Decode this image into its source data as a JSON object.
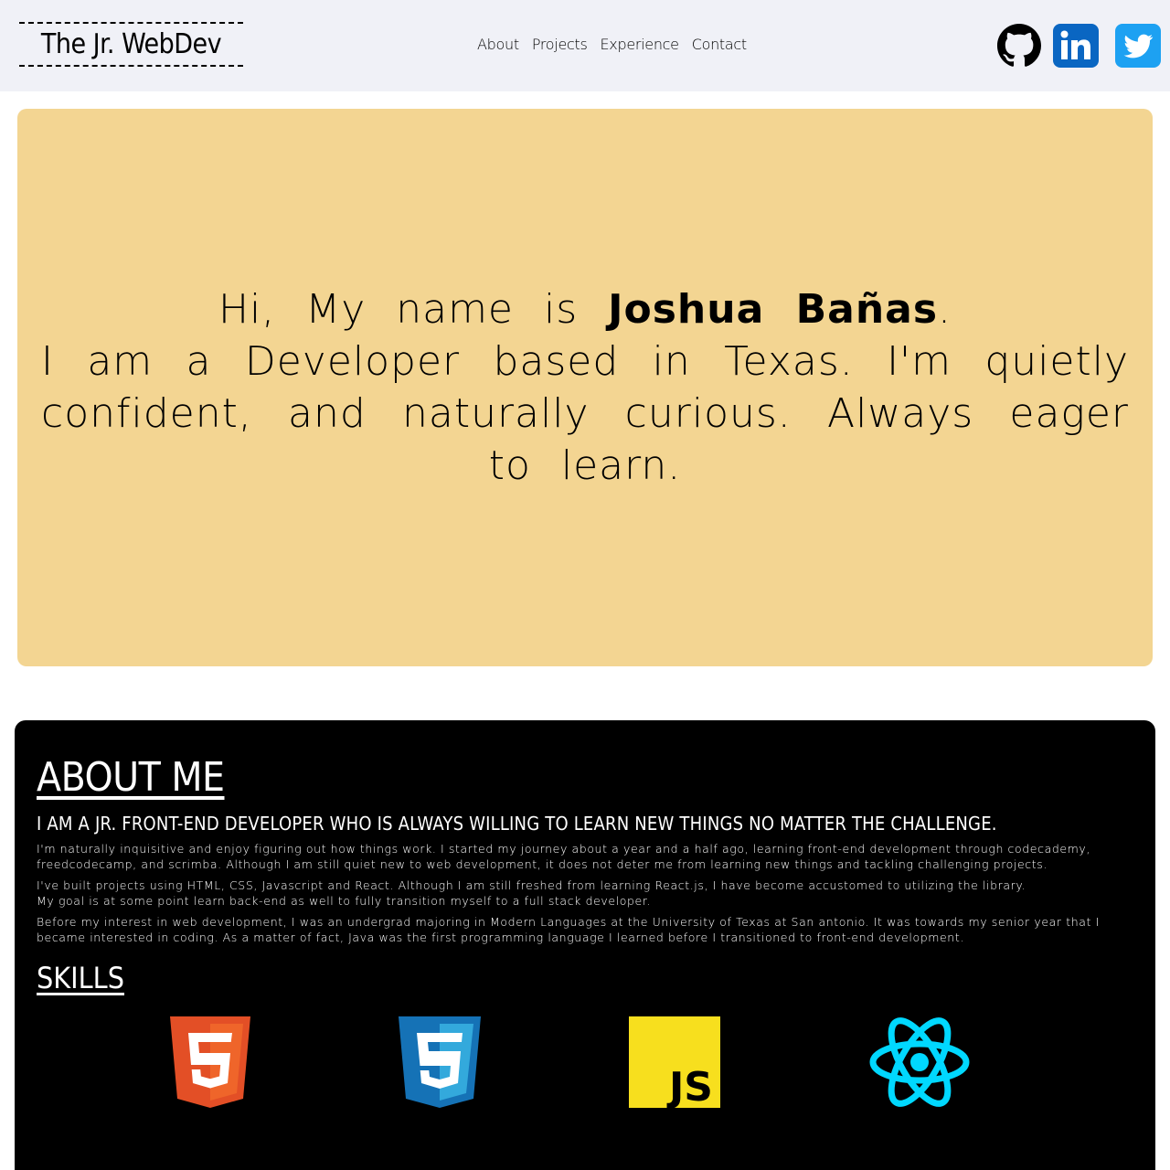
{
  "header": {
    "logo": "The Jr. WebDev",
    "nav": [
      "About",
      "Projects",
      "Experience",
      "Contact"
    ],
    "social": {
      "github": "github-icon",
      "linkedin": "linkedin-icon",
      "twitter": "twitter-icon"
    }
  },
  "hero": {
    "greeting": "Hi, My name is ",
    "name": "Joshua Bañas",
    "period": ".",
    "tagline": "I am a Developer based in Texas. I'm quietly confident, and naturally curious. Always eager to learn.",
    "background_color": "#f3d592"
  },
  "about": {
    "title": "ABOUT ME",
    "subtitle": "I AM A JR. FRONT-END DEVELOPER WHO IS ALWAYS WILLING TO LEARN NEW THINGS NO MATTER THE CHALLENGE.",
    "paragraphs": [
      "I'm naturally inquisitive and enjoy figuring out how things work. I started my journey about a year and a half ago, learning front-end development through codecademy, freedcodecamp, and scrimba. Although I am still quiet new to web development, it does not deter me from learning new things and tackling challenging projects.",
      "I've built projects using HTML, CSS, Javascript and React. Although I am still freshed from learning React.js, I have become accustomed to utilizing the library.",
      "My goal is at some point learn back-end as well to fully transition myself to a full stack developer.",
      "Before my interest in web development, I was an undergrad majoring in Modern Languages at the University of Texas at San antonio. It was towards my senior year that I became interested in coding. As a matter of fact, Java was the first programming language I learned before I transitioned to front-end development."
    ],
    "skills_title": "SKILLS",
    "skills": {
      "html_label": "5",
      "css_label": "3",
      "js_label": "JS"
    }
  },
  "colors": {
    "header_bg": "#f0f1f7",
    "hero_bg": "#f3d592",
    "about_bg": "#000000",
    "linkedin": "#0a66c2",
    "twitter": "#1da1f2",
    "html5": "#e34f26",
    "css3": "#1572b6",
    "js": "#f7df1e",
    "react": "#00d8ff"
  }
}
